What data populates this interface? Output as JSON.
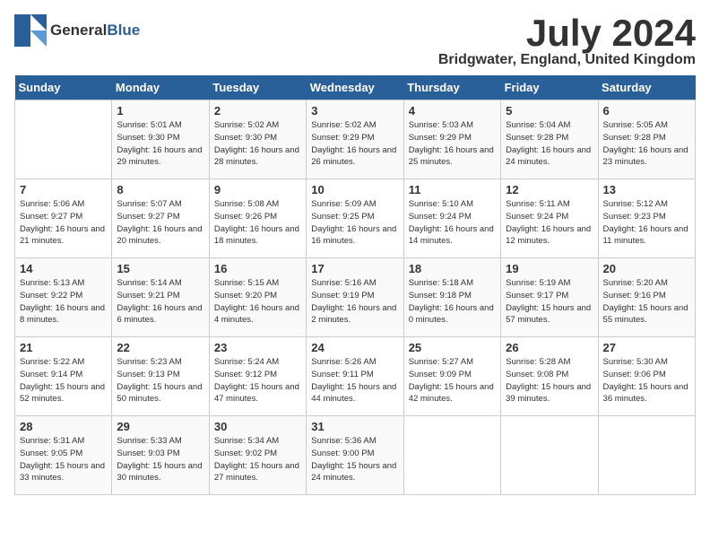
{
  "header": {
    "logo_general": "General",
    "logo_blue": "Blue",
    "title": "July 2024",
    "location": "Bridgwater, England, United Kingdom"
  },
  "weekdays": [
    "Sunday",
    "Monday",
    "Tuesday",
    "Wednesday",
    "Thursday",
    "Friday",
    "Saturday"
  ],
  "weeks": [
    [
      {
        "day": "",
        "sunrise": "",
        "sunset": "",
        "daylight": ""
      },
      {
        "day": "1",
        "sunrise": "Sunrise: 5:01 AM",
        "sunset": "Sunset: 9:30 PM",
        "daylight": "Daylight: 16 hours and 29 minutes."
      },
      {
        "day": "2",
        "sunrise": "Sunrise: 5:02 AM",
        "sunset": "Sunset: 9:30 PM",
        "daylight": "Daylight: 16 hours and 28 minutes."
      },
      {
        "day": "3",
        "sunrise": "Sunrise: 5:02 AM",
        "sunset": "Sunset: 9:29 PM",
        "daylight": "Daylight: 16 hours and 26 minutes."
      },
      {
        "day": "4",
        "sunrise": "Sunrise: 5:03 AM",
        "sunset": "Sunset: 9:29 PM",
        "daylight": "Daylight: 16 hours and 25 minutes."
      },
      {
        "day": "5",
        "sunrise": "Sunrise: 5:04 AM",
        "sunset": "Sunset: 9:28 PM",
        "daylight": "Daylight: 16 hours and 24 minutes."
      },
      {
        "day": "6",
        "sunrise": "Sunrise: 5:05 AM",
        "sunset": "Sunset: 9:28 PM",
        "daylight": "Daylight: 16 hours and 23 minutes."
      }
    ],
    [
      {
        "day": "7",
        "sunrise": "Sunrise: 5:06 AM",
        "sunset": "Sunset: 9:27 PM",
        "daylight": "Daylight: 16 hours and 21 minutes."
      },
      {
        "day": "8",
        "sunrise": "Sunrise: 5:07 AM",
        "sunset": "Sunset: 9:27 PM",
        "daylight": "Daylight: 16 hours and 20 minutes."
      },
      {
        "day": "9",
        "sunrise": "Sunrise: 5:08 AM",
        "sunset": "Sunset: 9:26 PM",
        "daylight": "Daylight: 16 hours and 18 minutes."
      },
      {
        "day": "10",
        "sunrise": "Sunrise: 5:09 AM",
        "sunset": "Sunset: 9:25 PM",
        "daylight": "Daylight: 16 hours and 16 minutes."
      },
      {
        "day": "11",
        "sunrise": "Sunrise: 5:10 AM",
        "sunset": "Sunset: 9:24 PM",
        "daylight": "Daylight: 16 hours and 14 minutes."
      },
      {
        "day": "12",
        "sunrise": "Sunrise: 5:11 AM",
        "sunset": "Sunset: 9:24 PM",
        "daylight": "Daylight: 16 hours and 12 minutes."
      },
      {
        "day": "13",
        "sunrise": "Sunrise: 5:12 AM",
        "sunset": "Sunset: 9:23 PM",
        "daylight": "Daylight: 16 hours and 11 minutes."
      }
    ],
    [
      {
        "day": "14",
        "sunrise": "Sunrise: 5:13 AM",
        "sunset": "Sunset: 9:22 PM",
        "daylight": "Daylight: 16 hours and 8 minutes."
      },
      {
        "day": "15",
        "sunrise": "Sunrise: 5:14 AM",
        "sunset": "Sunset: 9:21 PM",
        "daylight": "Daylight: 16 hours and 6 minutes."
      },
      {
        "day": "16",
        "sunrise": "Sunrise: 5:15 AM",
        "sunset": "Sunset: 9:20 PM",
        "daylight": "Daylight: 16 hours and 4 minutes."
      },
      {
        "day": "17",
        "sunrise": "Sunrise: 5:16 AM",
        "sunset": "Sunset: 9:19 PM",
        "daylight": "Daylight: 16 hours and 2 minutes."
      },
      {
        "day": "18",
        "sunrise": "Sunrise: 5:18 AM",
        "sunset": "Sunset: 9:18 PM",
        "daylight": "Daylight: 16 hours and 0 minutes."
      },
      {
        "day": "19",
        "sunrise": "Sunrise: 5:19 AM",
        "sunset": "Sunset: 9:17 PM",
        "daylight": "Daylight: 15 hours and 57 minutes."
      },
      {
        "day": "20",
        "sunrise": "Sunrise: 5:20 AM",
        "sunset": "Sunset: 9:16 PM",
        "daylight": "Daylight: 15 hours and 55 minutes."
      }
    ],
    [
      {
        "day": "21",
        "sunrise": "Sunrise: 5:22 AM",
        "sunset": "Sunset: 9:14 PM",
        "daylight": "Daylight: 15 hours and 52 minutes."
      },
      {
        "day": "22",
        "sunrise": "Sunrise: 5:23 AM",
        "sunset": "Sunset: 9:13 PM",
        "daylight": "Daylight: 15 hours and 50 minutes."
      },
      {
        "day": "23",
        "sunrise": "Sunrise: 5:24 AM",
        "sunset": "Sunset: 9:12 PM",
        "daylight": "Daylight: 15 hours and 47 minutes."
      },
      {
        "day": "24",
        "sunrise": "Sunrise: 5:26 AM",
        "sunset": "Sunset: 9:11 PM",
        "daylight": "Daylight: 15 hours and 44 minutes."
      },
      {
        "day": "25",
        "sunrise": "Sunrise: 5:27 AM",
        "sunset": "Sunset: 9:09 PM",
        "daylight": "Daylight: 15 hours and 42 minutes."
      },
      {
        "day": "26",
        "sunrise": "Sunrise: 5:28 AM",
        "sunset": "Sunset: 9:08 PM",
        "daylight": "Daylight: 15 hours and 39 minutes."
      },
      {
        "day": "27",
        "sunrise": "Sunrise: 5:30 AM",
        "sunset": "Sunset: 9:06 PM",
        "daylight": "Daylight: 15 hours and 36 minutes."
      }
    ],
    [
      {
        "day": "28",
        "sunrise": "Sunrise: 5:31 AM",
        "sunset": "Sunset: 9:05 PM",
        "daylight": "Daylight: 15 hours and 33 minutes."
      },
      {
        "day": "29",
        "sunrise": "Sunrise: 5:33 AM",
        "sunset": "Sunset: 9:03 PM",
        "daylight": "Daylight: 15 hours and 30 minutes."
      },
      {
        "day": "30",
        "sunrise": "Sunrise: 5:34 AM",
        "sunset": "Sunset: 9:02 PM",
        "daylight": "Daylight: 15 hours and 27 minutes."
      },
      {
        "day": "31",
        "sunrise": "Sunrise: 5:36 AM",
        "sunset": "Sunset: 9:00 PM",
        "daylight": "Daylight: 15 hours and 24 minutes."
      },
      {
        "day": "",
        "sunrise": "",
        "sunset": "",
        "daylight": ""
      },
      {
        "day": "",
        "sunrise": "",
        "sunset": "",
        "daylight": ""
      },
      {
        "day": "",
        "sunrise": "",
        "sunset": "",
        "daylight": ""
      }
    ]
  ]
}
